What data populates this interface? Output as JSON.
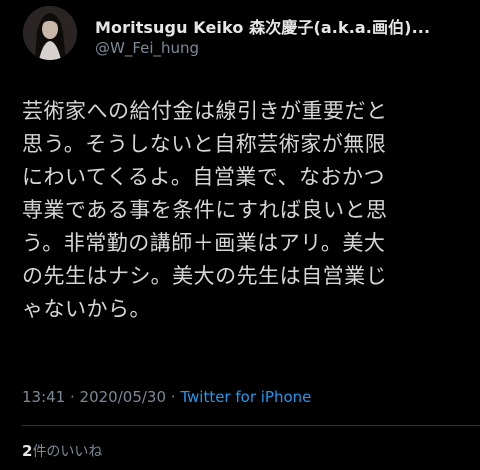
{
  "author": {
    "display_name": "Moritsugu Keiko 森次慶子(a.k.a.画伯)...",
    "handle": "@W_Fei_hung"
  },
  "tweet": {
    "lines": [
      "芸術家への給付金は線引きが重要だと",
      "思う。そうしないと自称芸術家が無限",
      "にわいてくるよ。自営業で、なおかつ",
      "専業である事を条件にすれば良いと思",
      "う。非常勤の講師＋画業はアリ。美大",
      "の先生はナシ。美大の先生は自営業じ",
      "ゃないから。"
    ]
  },
  "meta": {
    "time": "13:41",
    "separator1": " · ",
    "date": "2020/05/30",
    "separator2": " · ",
    "source": "Twitter for iPhone"
  },
  "stats": {
    "like_count": "2",
    "like_label": "件のいいね"
  },
  "colors": {
    "background": "#000000",
    "link": "#1d9bf0",
    "secondary_text": "#7b8a96"
  }
}
